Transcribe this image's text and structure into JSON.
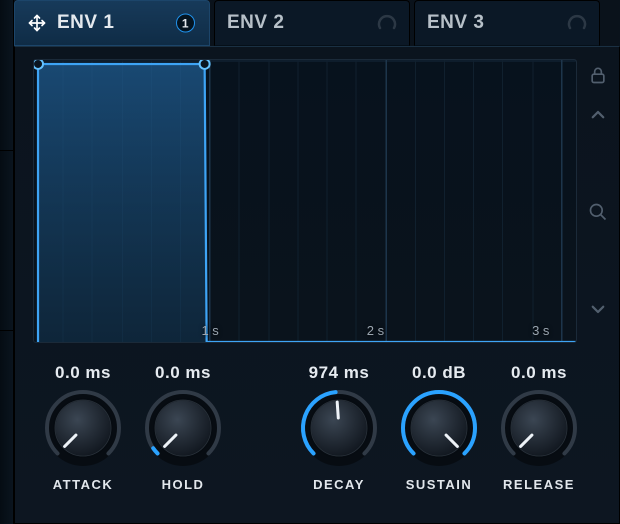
{
  "tabs": [
    {
      "label": "ENV 1",
      "active": true,
      "badge": "1"
    },
    {
      "label": "ENV 2",
      "active": false
    },
    {
      "label": "ENV 3",
      "active": false
    }
  ],
  "graph": {
    "ticks": [
      {
        "label": "1 s",
        "x_pct": 32.5
      },
      {
        "label": "2 s",
        "x_pct": 63.0
      },
      {
        "label": "3 s",
        "x_pct": 93.5
      }
    ]
  },
  "knobs": {
    "attack": {
      "value": "0.0 ms",
      "label": "ATTACK",
      "angle": -135,
      "acc": 0.0
    },
    "hold": {
      "value": "0.0 ms",
      "label": "HOLD",
      "angle": -135,
      "acc": 0.04
    },
    "decay": {
      "value": "974 ms",
      "label": "DECAY",
      "angle": -4,
      "acc": 0.48
    },
    "sustain": {
      "value": "0.0 dB",
      "label": "SUSTAIN",
      "angle": 135,
      "acc": 1.0
    },
    "release": {
      "value": "0.0 ms",
      "label": "RELEASE",
      "angle": -135,
      "acc": 0.0
    }
  },
  "icons": {
    "lock": "lock-icon",
    "up": "chevron-up-icon",
    "down": "chevron-down-icon",
    "search": "search-icon"
  }
}
